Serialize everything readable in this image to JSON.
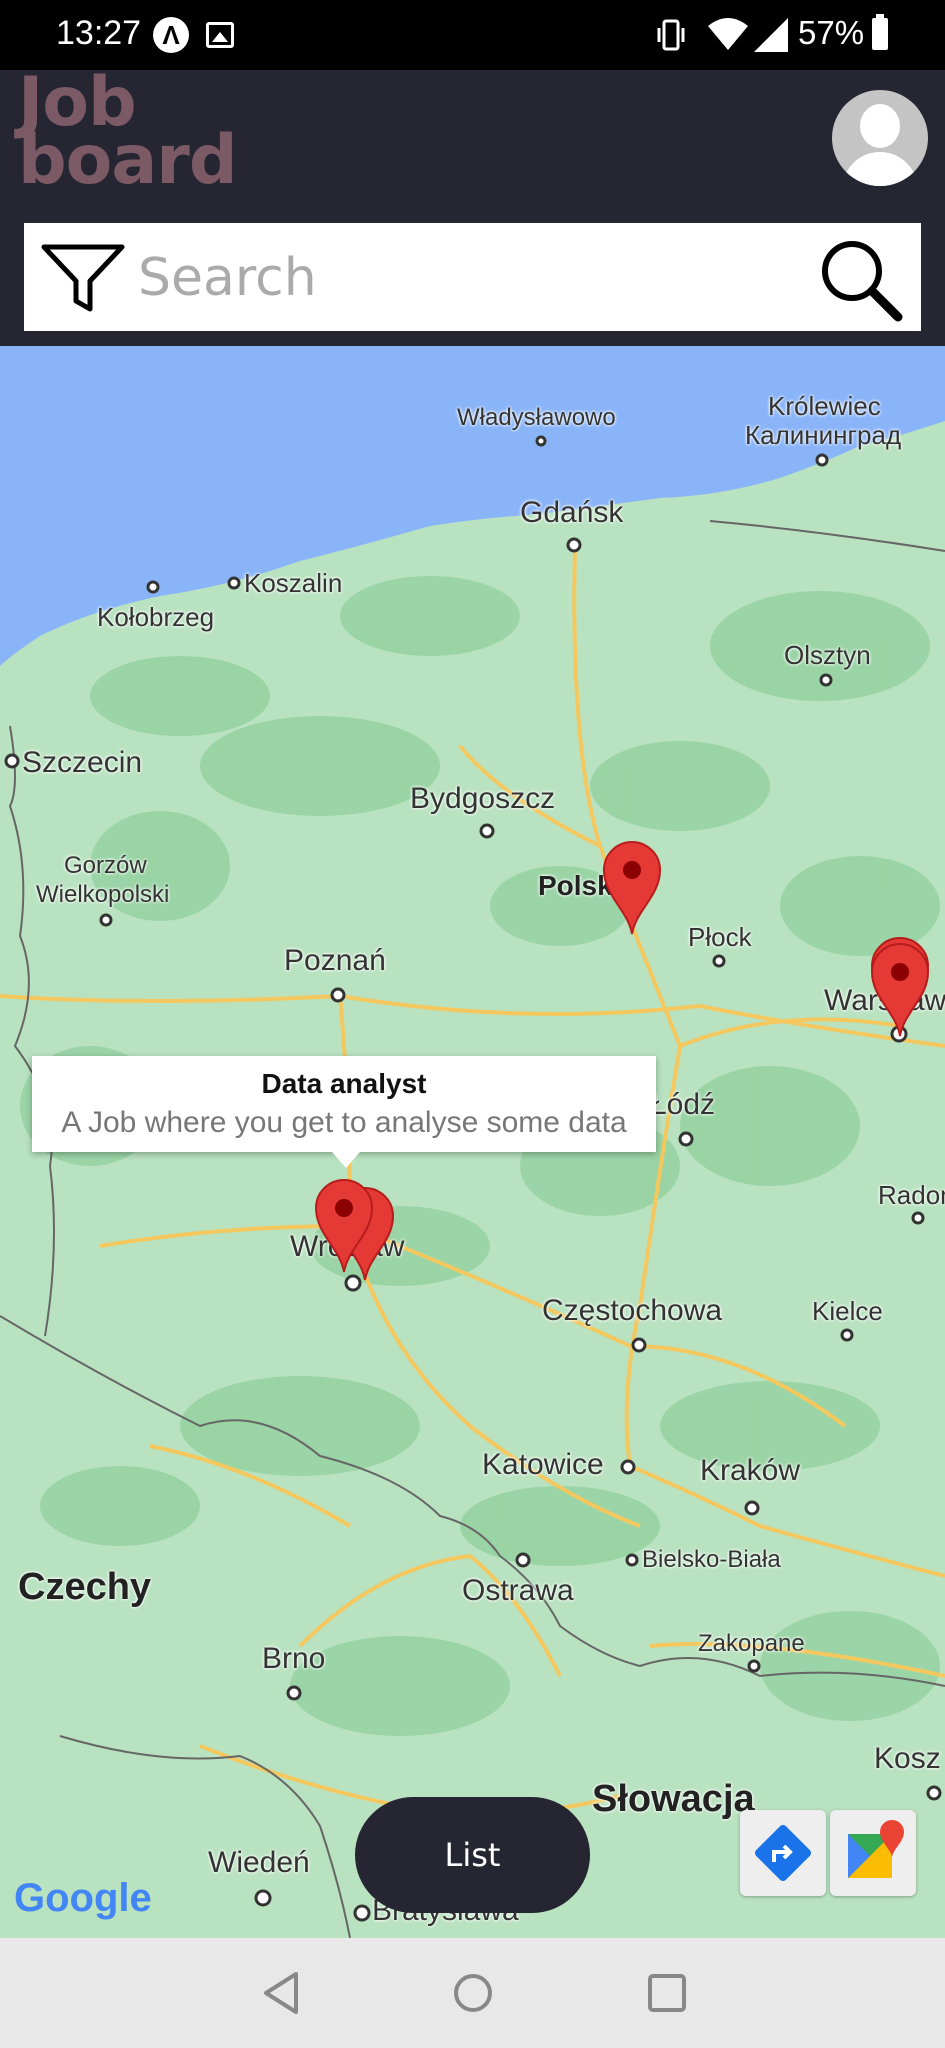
{
  "status_bar": {
    "time": "13:27",
    "battery_percent": "57%",
    "icons": [
      "accessibility-notification-icon",
      "image-notification-icon",
      "vibrate-icon",
      "wifi-icon",
      "cellular-signal-icon",
      "battery-icon"
    ]
  },
  "header": {
    "logo_line1": "Job",
    "logo_line2": "board",
    "avatar_icon": "user-avatar-icon"
  },
  "search": {
    "placeholder": "Search",
    "filter_icon": "filter-icon",
    "search_icon": "search-icon"
  },
  "map": {
    "labels": {
      "wladyslawowo": "Władysławowo",
      "krolewiec": "Królewiec",
      "kaliningrad": "Калининград",
      "gdansk": "Gdańsk",
      "koszalin": "Koszalin",
      "kolobrzeg": "Kołobrzeg",
      "olsztyn": "Olsztyn",
      "szczecin": "Szczecin",
      "bydgoszcz": "Bydgoszcz",
      "gorzow": "Gorzów",
      "wielkopolski": "Wielkopolski",
      "polska": "Polsk",
      "plock": "Płock",
      "poznan": "Poznań",
      "warszawa": "Warszaw",
      "lodz": "Łódź",
      "radom": "Radom",
      "wroclaw": "Wrocław",
      "czestochowa": "Częstochowa",
      "kielce": "Kielce",
      "katowice": "Katowice",
      "krakow": "Kraków",
      "czechy": "Czechy",
      "bielsko": "Bielsko-Biała",
      "ostrawa": "Ostrawa",
      "zakopane": "Zakopane",
      "brno": "Brno",
      "koszyce": "Kosz",
      "slowacja": "Słowacja",
      "wieden": "Wiedeń",
      "bratyslawa": "Bratysława"
    },
    "info_window": {
      "title": "Data analyst",
      "description": "A Job where you get to analyse some data"
    },
    "attribution": "Google",
    "pin_color": "#e53935",
    "directions_icon": "directions-icon",
    "open_maps_icon": "google-maps-icon"
  },
  "list_button": {
    "label": "List"
  },
  "nav_bar": {
    "back_icon": "back-triangle-icon",
    "home_icon": "home-circle-icon",
    "recents_icon": "recents-square-icon"
  },
  "colors": {
    "header_bg": "#262633",
    "logo": "#7b5a66",
    "water": "#8ab4f8",
    "land": "#b9e2c0",
    "road": "#f5c85f"
  }
}
